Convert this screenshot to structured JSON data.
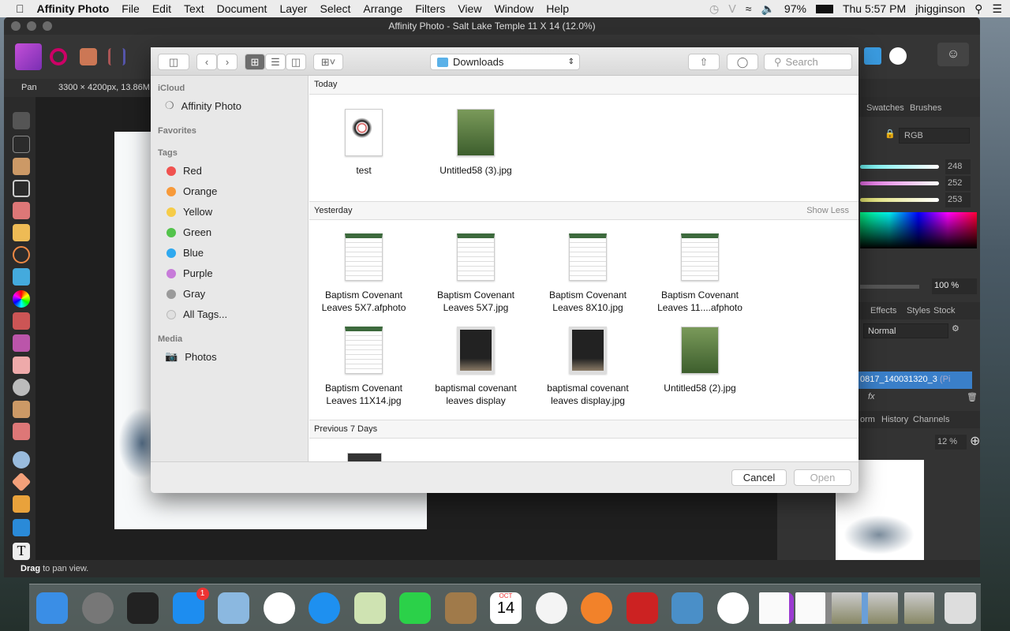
{
  "menubar": {
    "apple": "",
    "app": "Affinity Photo",
    "items": [
      "File",
      "Edit",
      "Text",
      "Document",
      "Layer",
      "Select",
      "Arrange",
      "Filters",
      "View",
      "Window",
      "Help"
    ],
    "battery": "97%",
    "clock": "Thu 5:57 PM",
    "user": "jhigginson"
  },
  "window": {
    "title": "Affinity Photo - Salt Lake Temple 11 X 14 (12.0%)",
    "tool": "Pan",
    "doc_info": "3300 × 4200px, 13.86M",
    "status_bold": "Drag",
    "status_rest": " to pan view."
  },
  "right_panel": {
    "tabs1": [
      "Swatches",
      "Brushes"
    ],
    "color_model": "RGB",
    "r": "248",
    "g": "252",
    "b": "253",
    "opacity": "100 %",
    "tabs2": [
      "Effects",
      "Styles",
      "Stock"
    ],
    "blend": "Normal",
    "layer_name": "0817_140031320_3",
    "layer_type": "(Pi",
    "tabs3": [
      "orm",
      "History",
      "Channels"
    ],
    "zoom": "12 %"
  },
  "dialog": {
    "location": "Downloads",
    "search_placeholder": "Search",
    "sidebar": {
      "icloud_head": "iCloud",
      "icloud_item": "Affinity Photo",
      "fav_head": "Favorites",
      "tags_head": "Tags",
      "tags": [
        {
          "label": "Red",
          "color": "#f0524f"
        },
        {
          "label": "Orange",
          "color": "#f79a3a"
        },
        {
          "label": "Yellow",
          "color": "#f6cc48"
        },
        {
          "label": "Green",
          "color": "#53c34b"
        },
        {
          "label": "Blue",
          "color": "#2fa9ef"
        },
        {
          "label": "Purple",
          "color": "#c77bd9"
        },
        {
          "label": "Gray",
          "color": "#9b9b9b"
        },
        {
          "label": "All Tags...",
          "color": "#e0e0e0"
        }
      ],
      "media_head": "Media",
      "media_item": "Photos"
    },
    "sections": {
      "today": "Today",
      "yesterday": "Yesterday",
      "show_less": "Show Less",
      "prev7": "Previous 7 Days"
    },
    "today_files": [
      {
        "l1": "test",
        "l2": ""
      },
      {
        "l1": "Untitled58 (3).jpg",
        "l2": ""
      }
    ],
    "yesterday_files": [
      {
        "l1": "Baptism Covenant",
        "l2": "Leaves 5X7.afphoto"
      },
      {
        "l1": "Baptism Covenant",
        "l2": "Leaves 5X7.jpg"
      },
      {
        "l1": "Baptism Covenant",
        "l2": "Leaves 8X10.jpg"
      },
      {
        "l1": "Baptism Covenant",
        "l2": "Leaves 11....afphoto"
      },
      {
        "l1": "Baptism Covenant",
        "l2": "Leaves 11X14.jpg"
      },
      {
        "l1": "baptismal covenant",
        "l2": "leaves display"
      },
      {
        "l1": "baptismal covenant",
        "l2": "leaves display.jpg"
      },
      {
        "l1": "Untitled58 (2).jpg",
        "l2": ""
      }
    ],
    "cancel": "Cancel",
    "open": "Open"
  },
  "dock": {
    "badge": "1",
    "calendar_month": "OCT",
    "calendar_day": "14",
    "apps": [
      "finder",
      "launchpad",
      "mission-control",
      "app-store",
      "mail",
      "chrome",
      "safari",
      "maps",
      "facetime",
      "contacts",
      "calendar",
      "itunes",
      "ibooks",
      "photo-booth",
      "preview",
      "photos",
      "affinity-photo",
      "system-preferences",
      "image-capture"
    ]
  }
}
